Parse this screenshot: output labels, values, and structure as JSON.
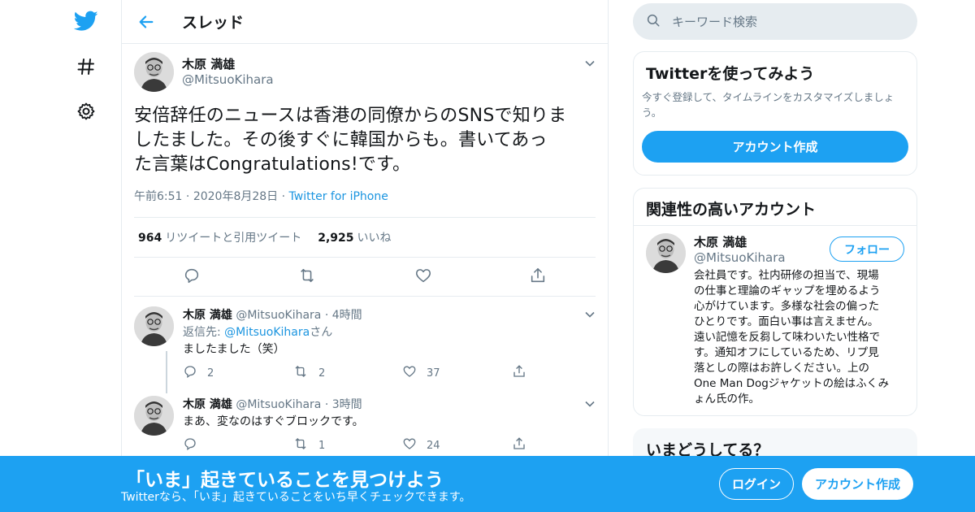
{
  "header": {
    "title": "スレッド"
  },
  "main_tweet": {
    "name": "木原 満雄",
    "handle": "@MitsuoKihara",
    "text_lines": [
      "安倍辞任のニュースは香港の同僚からのSNSで知りま",
      "したました。その後すぐに韓国からも。書いてあっ",
      "た言葉はCongratulations!です。"
    ],
    "time": "午前6:51",
    "sep": "·",
    "date": "2020年8月28日",
    "source": "Twitter for iPhone",
    "retweets_count": "964",
    "retweets_label": "リツイートと引用ツイート",
    "likes_count": "2,925",
    "likes_label": "いいね"
  },
  "replies": [
    {
      "name": "木原 満雄",
      "handle": "@MitsuoKihara",
      "sep": "·",
      "time": "4時間",
      "reply_to_prefix": "返信先: ",
      "reply_to_handle": "@MitsuoKihara",
      "reply_to_suffix": "さん",
      "text": "ましたました（笑）",
      "reply_count": "2",
      "retweet_count": "2",
      "like_count": "37"
    },
    {
      "name": "木原 満雄",
      "handle": "@MitsuoKihara",
      "sep": "·",
      "time": "3時間",
      "text": "まあ、変なのはすぐブロックです。",
      "reply_count": "",
      "retweet_count": "1",
      "like_count": "24"
    }
  ],
  "search": {
    "placeholder": "キーワード検索"
  },
  "signup_card": {
    "title": "Twitterを使ってみよう",
    "desc_lines": [
      "今すぐ登録して、タイムラインをカスタマイズしましょ",
      "う。"
    ],
    "button": "アカウント作成"
  },
  "related_card": {
    "title": "関連性の高いアカウント",
    "name": "木原 満雄",
    "handle": "@MitsuoKihara",
    "follow": "フォロー",
    "bio_lines": [
      "会社員です。社内研修の担当で、現場",
      "の仕事と理論のギャップを埋めるよう",
      "心がけています。多様な社会の偏った",
      "ひとりです。面白い事は言えません。",
      "遠い記憶を反芻して味わいたい性格で",
      "す。通知オフにしているため、リプ見",
      "落としの際はお許しください。上の",
      "One Man Dogジャケットの絵はふくみ",
      "ょん氏の作。"
    ]
  },
  "trends_card": {
    "title": "いまどうしてる？"
  },
  "banner": {
    "title": "「いま」起きていることを見つけよう",
    "subtitle": "Twitterなら、「いま」起きていることをいち早くチェックできます。",
    "login": "ログイン",
    "signup": "アカウント作成"
  },
  "colors": {
    "accent": "#1da1f2",
    "text": "#14171a",
    "secondary": "#657786",
    "border": "#e6ecf0"
  },
  "icons": [
    "twitter-bird-icon",
    "hashtag-icon",
    "gear-icon",
    "back-arrow-icon",
    "chevron-down-icon",
    "reply-icon",
    "retweet-icon",
    "heart-icon",
    "share-icon",
    "search-icon"
  ]
}
